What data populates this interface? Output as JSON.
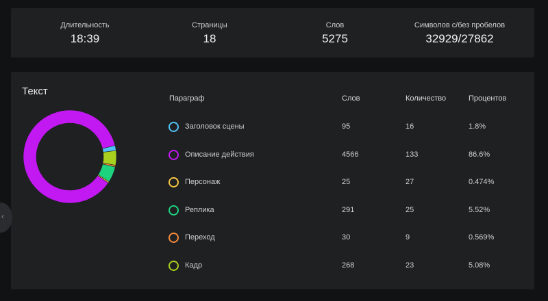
{
  "stats": [
    {
      "label": "Длительность",
      "value": "18:39"
    },
    {
      "label": "Страницы",
      "value": "18"
    },
    {
      "label": "Слов",
      "value": "5275"
    },
    {
      "label": "Символов с/без пробелов",
      "value": "32929/27862"
    }
  ],
  "text_panel": {
    "title": "Текст",
    "headers": {
      "paragraph": "Параграф",
      "words": "Слов",
      "count": "Количество",
      "percent": "Процентов"
    },
    "rows": [
      {
        "name": "Заголовок сцены",
        "words": "95",
        "count": "16",
        "percent": "1.8%",
        "color": "#4fc3f7"
      },
      {
        "name": "Описание действия",
        "words": "4566",
        "count": "133",
        "percent": "86.6%",
        "color": "#c218f2"
      },
      {
        "name": "Персонаж",
        "words": "25",
        "count": "27",
        "percent": "0.474%",
        "color": "#f5c542"
      },
      {
        "name": "Реплика",
        "words": "291",
        "count": "25",
        "percent": "5.52%",
        "color": "#1dd37e"
      },
      {
        "name": "Переход",
        "words": "30",
        "count": "9",
        "percent": "0.569%",
        "color": "#f58a3c"
      },
      {
        "name": "Кадр",
        "words": "268",
        "count": "23",
        "percent": "5.08%",
        "color": "#a8d01e"
      }
    ]
  },
  "donut": {
    "slices": [
      {
        "name": "Заголовок сцены",
        "percent": 1.8,
        "color": "#4fc3f7"
      },
      {
        "name": "Кадр",
        "percent": 5.08,
        "color": "#a8d01e"
      },
      {
        "name": "Переход",
        "percent": 0.569,
        "color": "#f58a3c"
      },
      {
        "name": "Реплика",
        "percent": 5.52,
        "color": "#1dd37e"
      },
      {
        "name": "Персонаж",
        "percent": 0.474,
        "color": "#f5c542"
      },
      {
        "name": "Описание действия",
        "percent": 86.6,
        "color": "#c218f2"
      }
    ]
  },
  "handle": {
    "glyph": "‹"
  }
}
